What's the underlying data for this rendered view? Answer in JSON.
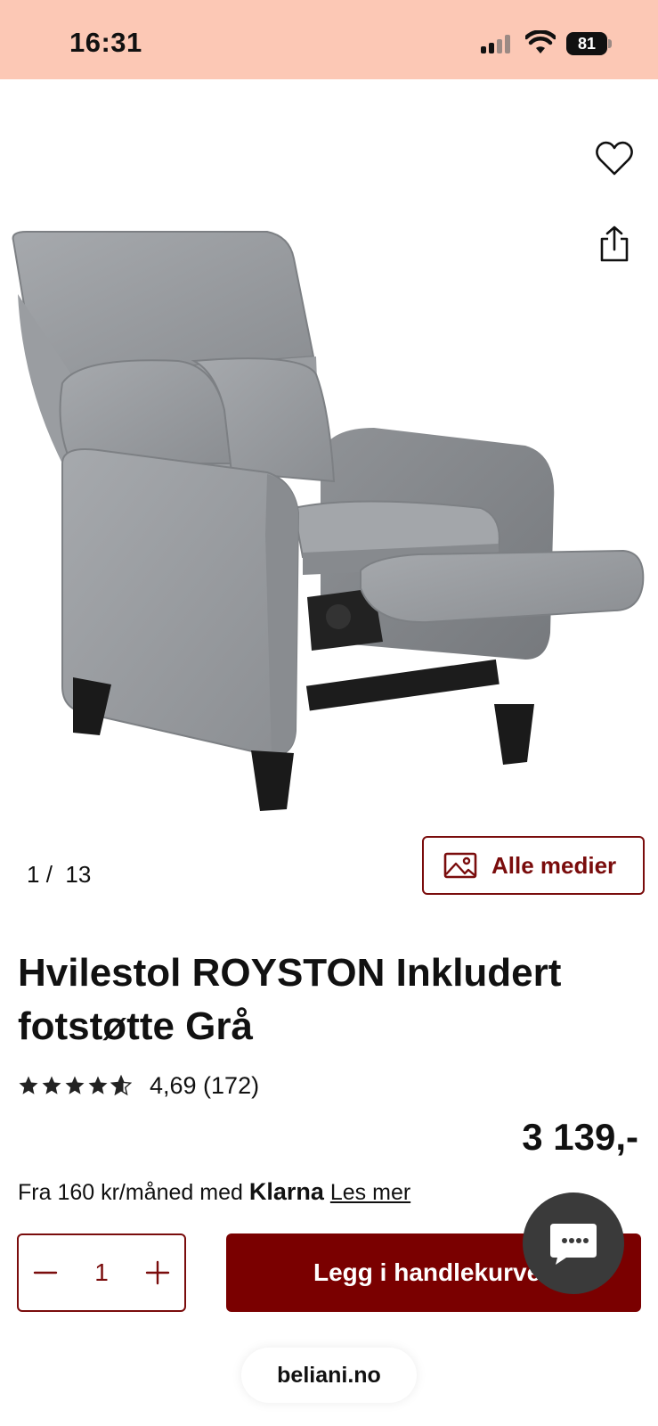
{
  "status_bar": {
    "time": "16:31",
    "battery": "81"
  },
  "gallery": {
    "index": "1",
    "separator": "/",
    "total": "13",
    "all_media_label": "Alle medier"
  },
  "product": {
    "title": "Hvilestol ROYSTON Inkludert fotstøtte Grå",
    "rating_value": 4.69,
    "rating_text": "4,69 (172)",
    "price": "3 139,-"
  },
  "financing": {
    "prefix": "Fra 160 kr/måned med",
    "brand": "Klarna",
    "link": "Les mer"
  },
  "cart": {
    "quantity": "1",
    "add_label": "Legg i handlekurven"
  },
  "browser": {
    "url": "beliani.no"
  },
  "colors": {
    "accent": "#7a0000",
    "status_bar": "#fcc8b5"
  }
}
